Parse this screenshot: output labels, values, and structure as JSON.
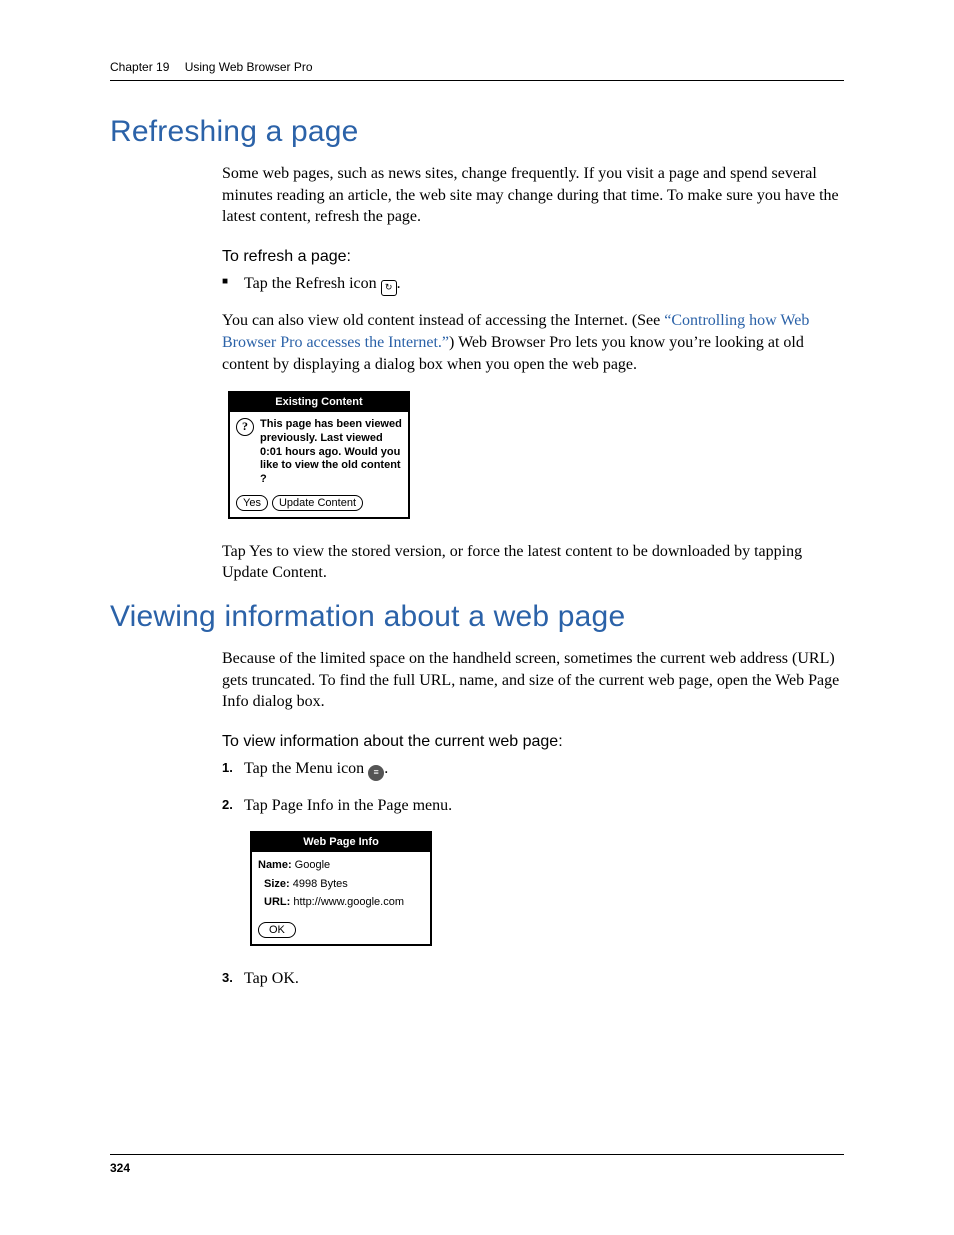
{
  "header": {
    "chapter": "Chapter 19",
    "title": "Using Web Browser Pro"
  },
  "section1": {
    "heading": "Refreshing a page",
    "para1": "Some web pages, such as news sites, change frequently. If you visit a page and spend several minutes reading an article, the web site may change during that time. To make sure you have the latest content, refresh the page.",
    "sub1": "To refresh a page:",
    "bullet1_prefix": "Tap the Refresh icon ",
    "bullet1_suffix": ".",
    "para2_prefix": "You can also view old content instead of accessing the Internet. (See ",
    "xref": "“Controlling how Web Browser Pro accesses the Internet.”",
    "para2_suffix": ") Web Browser Pro lets you know you’re looking at old content by displaying a dialog box when you open the web page.",
    "dialog": {
      "title": "Existing Content",
      "message": "This page has been viewed previously. Last viewed  0:01 hours ago. Would you like to view the old content ?",
      "yes": "Yes",
      "update": "Update Content"
    },
    "para3": "Tap Yes to view the stored version, or force the latest content to be downloaded by tapping Update Content."
  },
  "section2": {
    "heading": "Viewing information about a web page",
    "para1": "Because of the limited space on the handheld screen, sometimes the current web address (URL) gets truncated. To find the full URL, name, and size of the current web page, open the Web Page Info dialog box.",
    "sub1": "To view information about the current web page:",
    "step1_prefix": "Tap the Menu icon ",
    "step1_suffix": ".",
    "step2": "Tap Page Info in the Page menu.",
    "dialog": {
      "title": "Web Page Info",
      "name_label": "Name:",
      "name_value": " Google",
      "size_label": "Size:",
      "size_value": " 4998 Bytes",
      "url_label": "URL:",
      "url_value": " http://www.google.com",
      "ok": "OK"
    },
    "step3": "Tap OK."
  },
  "footer": {
    "pagenum": "324"
  }
}
